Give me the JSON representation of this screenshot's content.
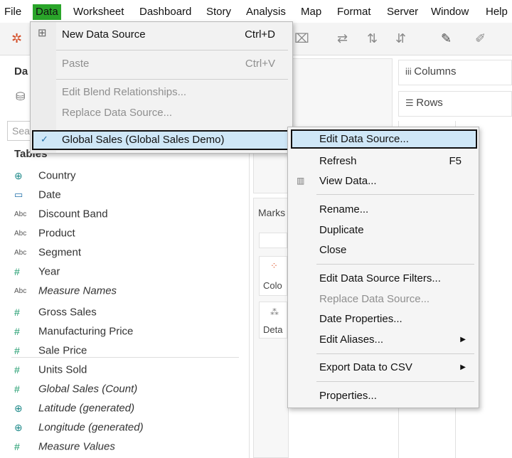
{
  "menubar": {
    "items": [
      {
        "label": "File"
      },
      {
        "label": "Data"
      },
      {
        "label": "Worksheet"
      },
      {
        "label": "Dashboard"
      },
      {
        "label": "Story"
      },
      {
        "label": "Analysis"
      },
      {
        "label": "Map"
      },
      {
        "label": "Format"
      },
      {
        "label": "Server"
      },
      {
        "label": "Window"
      },
      {
        "label": "Help"
      }
    ]
  },
  "datapane": {
    "title": "Da",
    "search_placeholder": "Sea",
    "tables_header": "Tables",
    "fields": [
      {
        "icon": "globe-icon",
        "glyph": "⊕",
        "label": "Country"
      },
      {
        "icon": "calendar-icon",
        "glyph": "▭",
        "label": "Date"
      },
      {
        "icon": "abc-icon",
        "glyph": "Abc",
        "label": "Discount Band"
      },
      {
        "icon": "abc-icon",
        "glyph": "Abc",
        "label": "Product"
      },
      {
        "icon": "abc-icon",
        "glyph": "Abc",
        "label": "Segment"
      },
      {
        "icon": "hash-icon",
        "glyph": "#",
        "label": "Year"
      },
      {
        "icon": "abc-icon",
        "glyph": "Abc",
        "label": "Measure Names"
      },
      {
        "icon": "hash-icon",
        "glyph": "#",
        "label": "Gross Sales"
      },
      {
        "icon": "hash-icon",
        "glyph": "#",
        "label": "Manufacturing Price"
      },
      {
        "icon": "hash-icon",
        "glyph": "#",
        "label": "Sale Price"
      },
      {
        "icon": "hash-icon",
        "glyph": "#",
        "label": "Units Sold"
      },
      {
        "icon": "hash-icon",
        "glyph": "#",
        "label": "Global Sales (Count)"
      },
      {
        "icon": "globe-icon",
        "glyph": "⊕",
        "label": "Latitude (generated)"
      },
      {
        "icon": "globe-icon",
        "glyph": "⊕",
        "label": "Longitude (generated)"
      },
      {
        "icon": "hash-icon",
        "glyph": "#",
        "label": "Measure Values"
      }
    ]
  },
  "shelves": {
    "columns": "Columns",
    "rows": "Rows",
    "marks": "Marks",
    "color": "Colo",
    "detail": "Deta"
  },
  "data_menu": {
    "new_data_source": "New Data Source",
    "new_data_source_shortcut": "Ctrl+D",
    "paste": "Paste",
    "paste_shortcut": "Ctrl+V",
    "edit_blend": "Edit Blend Relationships...",
    "replace": "Replace Data Source...",
    "current_source": "Global Sales (Global Sales Demo)"
  },
  "submenu": {
    "edit_data_source": "Edit Data Source...",
    "refresh": "Refresh",
    "refresh_shortcut": "F5",
    "view_data": "View Data...",
    "rename": "Rename...",
    "duplicate": "Duplicate",
    "close": "Close",
    "edit_filters": "Edit Data Source Filters...",
    "replace": "Replace Data Source...",
    "date_properties": "Date Properties...",
    "edit_aliases": "Edit Aliases...",
    "export_csv": "Export Data to CSV",
    "properties": "Properties..."
  }
}
